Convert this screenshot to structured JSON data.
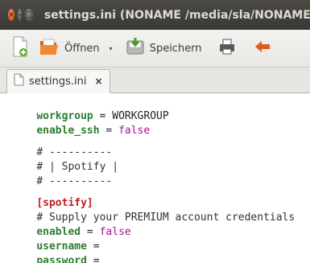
{
  "window": {
    "title": "settings.ini (NONAME /media/sla/NONAME",
    "close_glyph": "×",
    "min_glyph": "–",
    "max_glyph": "□"
  },
  "toolbar": {
    "new_icon": "new-document-icon",
    "open_label": "Öffnen",
    "open_dropdown_glyph": "▾",
    "save_label": "Speichern",
    "print_icon": "print-icon",
    "undo_icon": "undo-icon"
  },
  "tabs": [
    {
      "label": "settings.ini",
      "close_glyph": "×"
    }
  ],
  "editor": {
    "lines": [
      {
        "key": "workgroup",
        "eq": " = ",
        "value": "WORKGROUP"
      },
      {
        "key": "enable_ssh",
        "eq": " = ",
        "value": "false"
      },
      {
        "comment": "# ----------"
      },
      {
        "comment": "# | Spotify |"
      },
      {
        "comment": "# ----------"
      },
      {
        "section": "[spotify]"
      },
      {
        "comment": "# Supply your PREMIUM account credentials"
      },
      {
        "key": "enabled",
        "eq": " = ",
        "value": "false"
      },
      {
        "key": "username",
        "eq": " ="
      },
      {
        "key": "password",
        "eq": " ="
      }
    ]
  },
  "colors": {
    "titlebar": "#3c3b37",
    "close_button": "#e0541f",
    "key": "#2e7d32",
    "boolean": "#a0188f",
    "section": "#c21f1f"
  }
}
